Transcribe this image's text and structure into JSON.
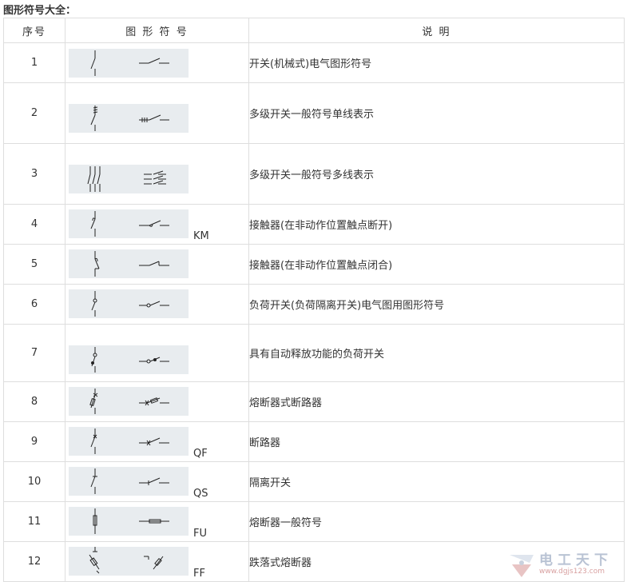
{
  "heading": "图形符号大全：",
  "table": {
    "headers": [
      "序号",
      "图 形 符 号",
      "说 明"
    ],
    "rows": [
      {
        "num": "1",
        "code": "",
        "desc": "开关(机械式)电气图形符号",
        "icon": "mechanical-switch-icon"
      },
      {
        "num": "2",
        "code": "",
        "desc": "多级开关一般符号单线表示",
        "icon": "multipole-switch-single-line-icon"
      },
      {
        "num": "3",
        "code": "",
        "desc": "多级开关一般符号多线表示",
        "icon": "multipole-switch-multi-line-icon"
      },
      {
        "num": "4",
        "code": "KM",
        "desc": "接触器(在非动作位置触点断开)",
        "icon": "contactor-no-icon"
      },
      {
        "num": "5",
        "code": "",
        "desc": "接触器(在非动作位置触点闭合)",
        "icon": "contactor-nc-icon"
      },
      {
        "num": "6",
        "code": "",
        "desc": "负荷开关(负荷隔离开关)电气图用图形符号",
        "icon": "load-switch-icon"
      },
      {
        "num": "7",
        "code": "",
        "desc": "具有自动释放功能的负荷开关",
        "icon": "auto-release-load-switch-icon"
      },
      {
        "num": "8",
        "code": "",
        "desc": "熔断器式断路器",
        "icon": "fuse-breaker-icon"
      },
      {
        "num": "9",
        "code": "QF",
        "desc": "断路器",
        "icon": "circuit-breaker-icon"
      },
      {
        "num": "10",
        "code": "QS",
        "desc": "隔离开关",
        "icon": "disconnector-icon"
      },
      {
        "num": "11",
        "code": "FU",
        "desc": "熔断器一般符号",
        "icon": "fuse-icon"
      },
      {
        "num": "12",
        "code": "FF",
        "desc": "跌落式熔断器",
        "icon": "drop-out-fuse-icon"
      }
    ]
  },
  "watermark": {
    "title": "电工天下",
    "url": "www.dgjs123.com"
  }
}
